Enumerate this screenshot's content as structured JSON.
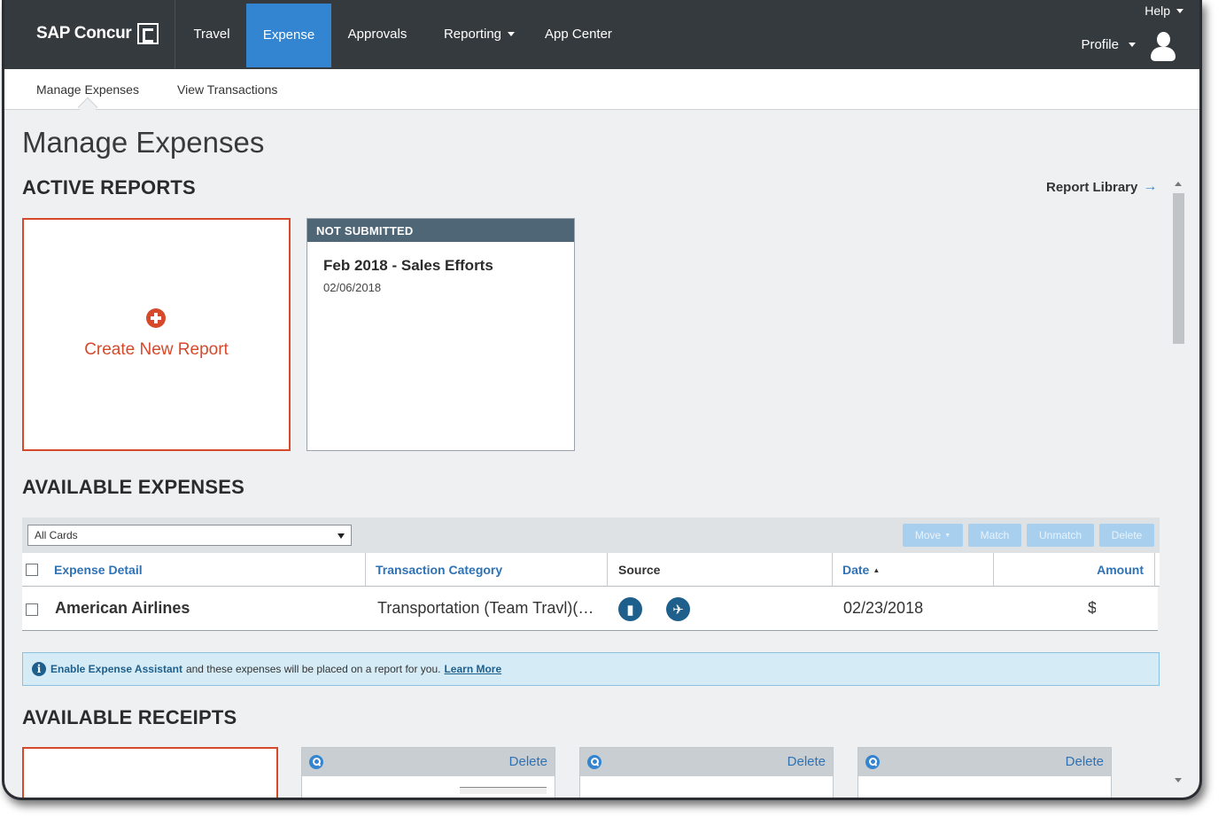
{
  "brand": {
    "name": "SAP Concur"
  },
  "topnav": {
    "items": [
      {
        "label": "Travel"
      },
      {
        "label": "Expense"
      },
      {
        "label": "Approvals"
      },
      {
        "label": "Reporting"
      },
      {
        "label": "App Center"
      }
    ],
    "active": "Expense",
    "help_label": "Help",
    "profile_label": "Profile"
  },
  "subnav": {
    "items": [
      {
        "label": "Manage Expenses"
      },
      {
        "label": "View Transactions"
      }
    ],
    "active": "Manage Expenses"
  },
  "page": {
    "title": "Manage Expenses"
  },
  "active_reports": {
    "heading": "ACTIVE REPORTS",
    "library_link": "Report Library",
    "create_label": "Create New Report",
    "reports": [
      {
        "status": "NOT SUBMITTED",
        "name": "Feb 2018 - Sales Efforts",
        "date": "02/06/2018"
      }
    ]
  },
  "available_expenses": {
    "heading": "AVAILABLE EXPENSES",
    "filter_value": "All Cards",
    "buttons": {
      "move": "Move",
      "match": "Match",
      "unmatch": "Unmatch",
      "delete": "Delete"
    },
    "columns": {
      "detail": "Expense Detail",
      "category": "Transaction Category",
      "source": "Source",
      "date": "Date",
      "amount": "Amount"
    },
    "sort": {
      "column": "Date",
      "direction": "ascending"
    },
    "rows": [
      {
        "detail": "American Airlines",
        "category": "Transportation (Team Travl)(…",
        "sources": [
          "card-icon",
          "airplane-icon"
        ],
        "date": "02/23/2018",
        "currency": "$"
      }
    ],
    "info": {
      "strong": "Enable Expense Assistant",
      "text": "and these expenses will be placed on a report for you.",
      "link": "Learn More"
    }
  },
  "available_receipts": {
    "heading": "AVAILABLE RECEIPTS",
    "cards": [
      {
        "delete_label": "Delete"
      },
      {
        "delete_label": "Delete"
      },
      {
        "delete_label": "Delete"
      }
    ]
  },
  "colors": {
    "nav_bg": "#353a3f",
    "accent": "#3385d1",
    "create": "#d6492b",
    "status_bar": "#4f6677",
    "link": "#2f72b4"
  }
}
